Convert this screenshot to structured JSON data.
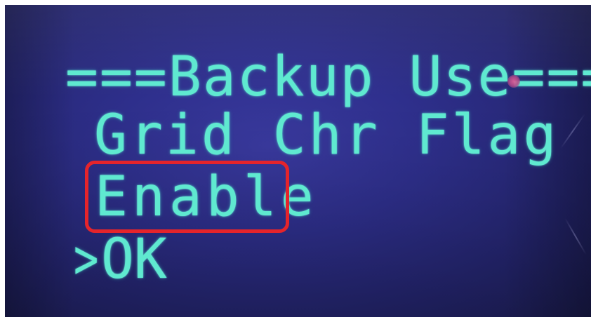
{
  "display": {
    "title_line": "===Backup Use===",
    "option_label": "Grid Chr Flag",
    "option_value": "Enable",
    "cursor_symbol": ">",
    "confirm_label": "OK"
  },
  "colors": {
    "lcd_background": "#2e2f8c",
    "lcd_text": "#5fe9d0",
    "highlight_border": "#e5242b",
    "frame": "#ffffff"
  },
  "icons": {
    "cursor": "right-angle-cursor-icon"
  }
}
